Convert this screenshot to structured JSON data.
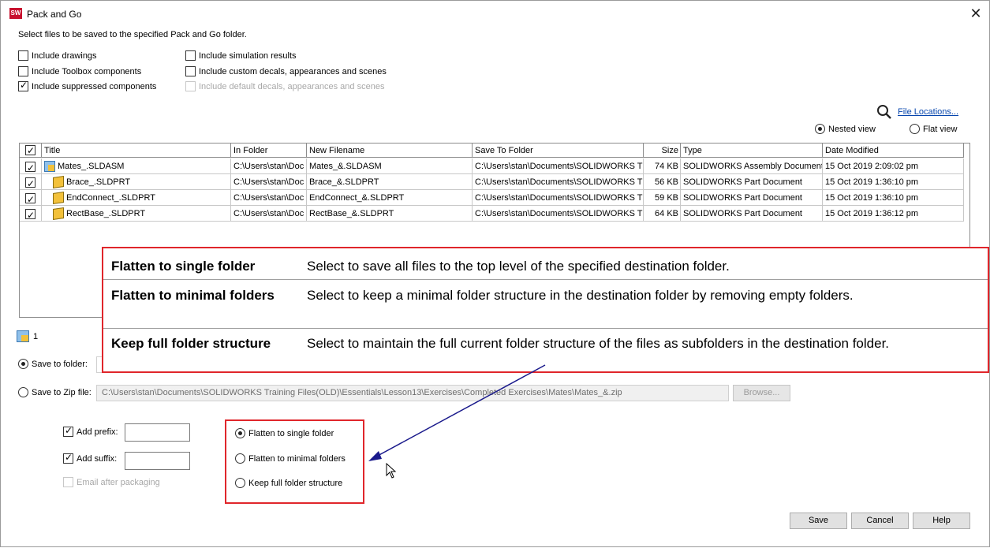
{
  "window": {
    "title": "Pack and Go",
    "close_glyph": "✕",
    "app_icon": "SW"
  },
  "instructions": "Select files to be saved to the specified Pack and Go folder.",
  "options": {
    "include_drawings": {
      "label": "Include drawings",
      "checked": false
    },
    "include_toolbox": {
      "label": "Include Toolbox components",
      "checked": false
    },
    "include_suppressed": {
      "label": "Include suppressed components",
      "checked": true
    },
    "include_simulation": {
      "label": "Include simulation results",
      "checked": false
    },
    "include_custom_decals": {
      "label": "Include custom decals, appearances and scenes",
      "checked": false
    },
    "include_default_decals": {
      "label": "Include default decals, appearances and scenes",
      "checked": false,
      "disabled": true
    }
  },
  "file_locations_link": "File Locations...",
  "view": {
    "nested_label": "Nested view",
    "flat_label": "Flat view",
    "selected": "nested"
  },
  "table": {
    "columns": [
      "Title",
      "In Folder",
      "New Filename",
      "Save To Folder",
      "Size",
      "Type",
      "Date Modified"
    ],
    "rows": [
      {
        "title": "Mates_.SLDASM",
        "in_folder": "C:\\Users\\stan\\Doc",
        "new_filename": "Mates_&.SLDASM",
        "save_to": "C:\\Users\\stan\\Documents\\SOLIDWORKS T",
        "size": "74 KB",
        "type": "SOLIDWORKS Assembly Document",
        "date": "15 Oct 2019 2:09:02 pm",
        "icon": "assembly-icon"
      },
      {
        "title": "Brace_.SLDPRT",
        "in_folder": "C:\\Users\\stan\\Doc",
        "new_filename": "Brace_&.SLDPRT",
        "save_to": "C:\\Users\\stan\\Documents\\SOLIDWORKS T",
        "size": "56 KB",
        "type": "SOLIDWORKS Part Document",
        "date": "15 Oct 2019 1:36:10 pm",
        "icon": "part-icon"
      },
      {
        "title": "EndConnect_.SLDPRT",
        "in_folder": "C:\\Users\\stan\\Doc",
        "new_filename": "EndConnect_&.SLDPRT",
        "save_to": "C:\\Users\\stan\\Documents\\SOLIDWORKS T",
        "size": "59 KB",
        "type": "SOLIDWORKS Part Document",
        "date": "15 Oct 2019 1:36:10 pm",
        "icon": "part-icon"
      },
      {
        "title": "RectBase_.SLDPRT",
        "in_folder": "C:\\Users\\stan\\Doc",
        "new_filename": "RectBase_&.SLDPRT",
        "save_to": "C:\\Users\\stan\\Documents\\SOLIDWORKS T",
        "size": "64 KB",
        "type": "SOLIDWORKS Part Document",
        "date": "15 Oct 2019 1:36:12 pm",
        "icon": "part-icon"
      }
    ]
  },
  "callout": [
    {
      "term": "Flatten to single folder",
      "desc": "Select to save all files to the top level of the specified destination folder."
    },
    {
      "term": "Flatten to minimal folders",
      "desc": "Select to keep a minimal folder structure in the destination folder by removing empty folders."
    },
    {
      "term": "Keep full folder structure",
      "desc": "Select to maintain the full current folder structure of the files as subfolders in the destination folder."
    }
  ],
  "summary_count": "1",
  "destination": {
    "save_to_folder_label": "Save to folder:",
    "save_to_zip_label": "Save to Zip file:",
    "zip_path": "C:\\Users\\stan\\Documents\\SOLIDWORKS Training Files(OLD)\\Essentials\\Lesson13\\Exercises\\Completed Exercises\\Mates\\Mates_&.zip",
    "browse_label": "Browse...",
    "selected": "folder"
  },
  "naming": {
    "add_prefix": {
      "label": "Add prefix:",
      "checked": true,
      "value": ""
    },
    "add_suffix": {
      "label": "Add suffix:",
      "checked": true,
      "value": ""
    },
    "email_after": {
      "label": "Email after packaging",
      "checked": false,
      "disabled": true
    }
  },
  "structure_options": {
    "flatten_single": "Flatten to single folder",
    "flatten_minimal": "Flatten to minimal folders",
    "keep_full": "Keep full folder structure",
    "selected": "flatten_single"
  },
  "buttons": {
    "save": "Save",
    "cancel": "Cancel",
    "help": "Help"
  },
  "colors": {
    "callout_border": "#e0262b",
    "arrow": "#1a1a8c",
    "link": "#0645ad"
  }
}
